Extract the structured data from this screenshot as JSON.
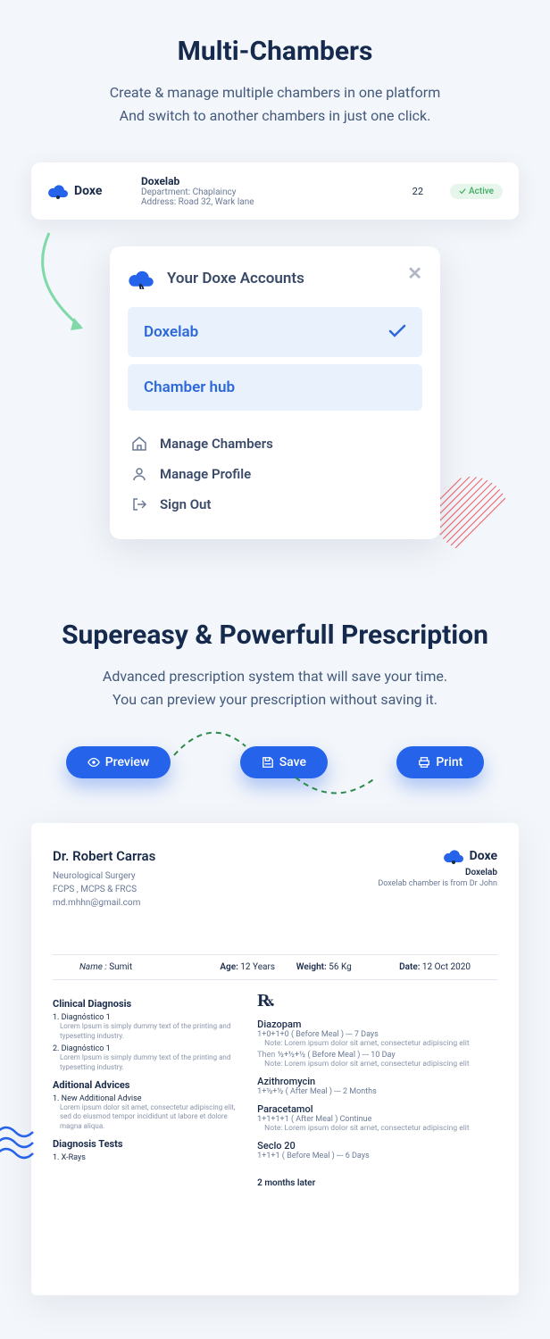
{
  "section1": {
    "title": "Multi-Chambers",
    "desc1": "Create & manage multiple chambers in one platform",
    "desc2": "And switch to another chambers in just one click.",
    "brand": "Doxe",
    "card": {
      "name": "Doxelab",
      "dept": "Department: Chaplaincy",
      "addr": "Address: Road 32, Wark lane",
      "count": "22",
      "badge": "Active"
    },
    "accounts": {
      "title": "Your Doxe Accounts",
      "items": [
        {
          "label": "Doxelab",
          "selected": true
        },
        {
          "label": "Chamber hub",
          "selected": false
        }
      ],
      "menu": [
        {
          "label": "Manage Chambers",
          "icon": "home"
        },
        {
          "label": "Manage Profile",
          "icon": "user"
        },
        {
          "label": "Sign Out",
          "icon": "signout"
        }
      ]
    }
  },
  "section2": {
    "title": "Supereasy & Powerfull Prescription",
    "desc1": "Advanced prescription system that will save your time.",
    "desc2": "You can preview your prescription without saving it.",
    "buttons": {
      "preview": "Preview",
      "save": "Save",
      "print": "Print"
    }
  },
  "rx": {
    "doctor": {
      "name": "Dr. Robert Carras",
      "spec": "Neurological Surgery",
      "cred": "FCPS , MCPS  & FRCS",
      "email": "md.mhhn@gmail.com"
    },
    "brand": {
      "name": "Doxe",
      "chamber": "Doxelab",
      "desc": "Doxelab chamber is from Dr John"
    },
    "patient": {
      "name_label": "Name :",
      "name": "Sumit",
      "age_label": "Age:",
      "age": "12 Years",
      "weight_label": "Weight:",
      "weight": "56 Kg",
      "date_label": "Date:",
      "date": "12 Oct 2020"
    },
    "diagnosis": {
      "title": "Clinical Diagnosis",
      "items": [
        {
          "t": "1. Diagnóstico 1",
          "d": "Lorem Ipsum is simply dummy text of the printing and typesetting industry."
        },
        {
          "t": "2. Diagnóstico 1",
          "d": "Lorem Ipsum is simply dummy text of the printing and typesetting industry."
        }
      ]
    },
    "advices": {
      "title": "Aditional Advices",
      "items": [
        {
          "t": "1. New Additional Advise",
          "d": "Lorem ipsum dolor sit amet, consectetur adipiscing elit, sed do eiusmod tempor incididunt ut labore et dolore magna aliqua."
        }
      ]
    },
    "tests": {
      "title": "Diagnosis Tests",
      "items": [
        {
          "t": "1. X-Rays"
        }
      ]
    },
    "meds": [
      {
        "name": "Diazopam",
        "doses": [
          {
            "d": "1+0+1+0 ( Before Meal ) --- 7 Days",
            "note": "Note: Lorem ipsum dolor sit amet, consectetur adipiscing elit"
          },
          {
            "prefix": "Then",
            "d": "½+½+½ ( Before Meal ) --- 10 Day",
            "note": "Note: Lorem ipsum dolor sit amet, consectetur adipiscing elit"
          }
        ]
      },
      {
        "name": "Azithromycin",
        "doses": [
          {
            "d": "1+½+½ ( After Meal ) --- 2 Months"
          }
        ]
      },
      {
        "name": "Paracetamol",
        "doses": [
          {
            "d": "1+1+1+1 ( After Meal ) Continue",
            "note": "Note: Lorem ipsum dolor sit amet, consectetur adipiscing elit"
          }
        ]
      },
      {
        "name": "Seclo 20",
        "doses": [
          {
            "d": "1+1+1 ( Before Meal ) --- 6 Days"
          }
        ]
      }
    ],
    "followup": "2 months later"
  }
}
